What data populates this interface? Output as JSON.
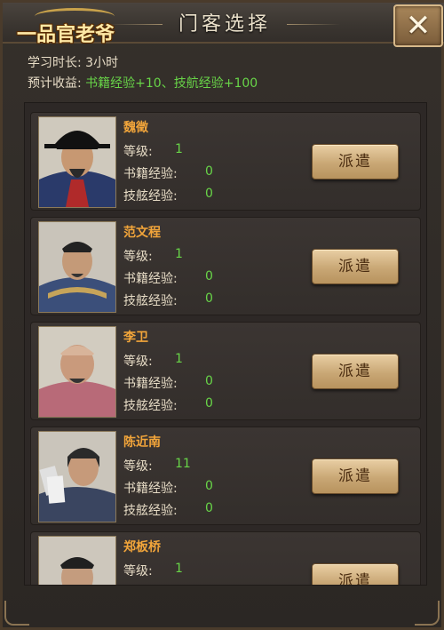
{
  "window": {
    "title": "门客选择",
    "logo_text": "一品官老爷",
    "close_label": "✕"
  },
  "info": {
    "study_label": "学习时长:",
    "study_value": "3小时",
    "reward_label": "预计收益:",
    "reward_value": "书籍经验+10、技航经验+100"
  },
  "labels": {
    "level": "等级:",
    "book_exp": "书籍经验:",
    "skill_exp": "技舷经验:",
    "dispatch": "派遣"
  },
  "retainers": [
    {
      "name": "魏徵",
      "level": "1",
      "book_exp": "0",
      "skill_exp": "0",
      "portrait_colors": [
        "#2a3a6a",
        "#b02a2a",
        "#111111"
      ]
    },
    {
      "name": "范文程",
      "level": "1",
      "book_exp": "0",
      "skill_exp": "0",
      "portrait_colors": [
        "#3b4f7a",
        "#c6a45a",
        "#222222"
      ]
    },
    {
      "name": "李卫",
      "level": "1",
      "book_exp": "0",
      "skill_exp": "0",
      "portrait_colors": [
        "#b86a78",
        "#e8c8a8",
        "#333333"
      ]
    },
    {
      "name": "陈近南",
      "level": "11",
      "book_exp": "0",
      "skill_exp": "0",
      "portrait_colors": [
        "#3a4560",
        "#e0e0e0",
        "#2a2a2a"
      ]
    },
    {
      "name": "郑板桥",
      "level": "1",
      "book_exp": "",
      "skill_exp": "",
      "portrait_colors": [
        "#6a5a40",
        "#d8c0a0",
        "#202020"
      ]
    }
  ]
}
